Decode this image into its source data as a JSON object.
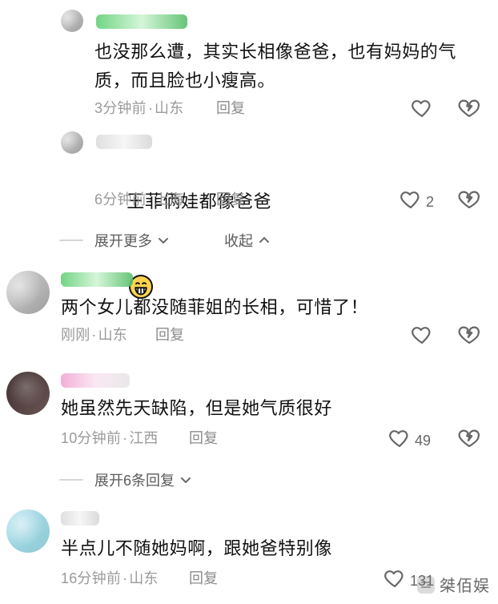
{
  "comments": [
    {
      "id": "c1",
      "avatar": {
        "kind": "small"
      },
      "name_style": "green",
      "text": "也没那么遭，其实长相像爸爸，也有妈妈的气\n质，而且脸也小瘦高。",
      "time": "3分钟前",
      "location": "山东",
      "reply_label": "回复",
      "likes": ""
    },
    {
      "id": "c2",
      "avatar": {
        "kind": "small"
      },
      "name_style": "plain",
      "text": "王菲俩娃都像爸爸",
      "time": "6分钟前",
      "location": "上海",
      "reply_label": "回复",
      "likes": "2"
    },
    {
      "id": "c3",
      "avatar": {
        "kind": "large"
      },
      "name_style": "green",
      "text": "两个女儿都没随菲姐的长相，可惜了！",
      "time": "刚刚",
      "location": "山东",
      "reply_label": "回复",
      "likes": ""
    },
    {
      "id": "c4",
      "avatar": {
        "kind": "large"
      },
      "name_style": "pink",
      "text": "她虽然先天缺陷，但是她气质很好",
      "time": "10分钟前",
      "location": "江西",
      "reply_label": "回复",
      "likes": "49"
    },
    {
      "id": "c5",
      "avatar": {
        "kind": "large"
      },
      "name_style": "plain",
      "text": "半点儿不随她妈啊，跟她爸特别像",
      "time": "16分钟前",
      "location": "山东",
      "reply_label": "回复",
      "likes": "131"
    }
  ],
  "threads": {
    "expand_more": "展开更多",
    "collapse": "收起",
    "expand_replies": "展开6条回复"
  },
  "watermark": {
    "text": "桀佰娱"
  },
  "icons": {
    "like": "heart-outline-icon",
    "dislike": "broken-heart-icon",
    "chevron_down": "chevron-down-icon",
    "chevron_up": "chevron-up-icon",
    "emoji": "grinning-face-icon"
  }
}
